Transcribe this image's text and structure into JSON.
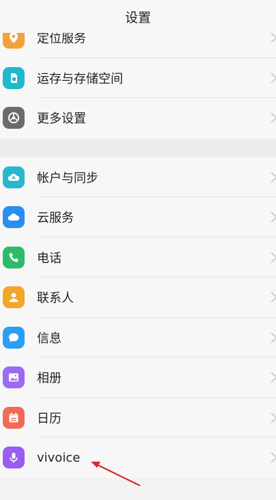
{
  "header": {
    "title": "设置"
  },
  "group1": [
    {
      "label": "定位服务",
      "icon": "location-icon",
      "color": "#f2a23a"
    },
    {
      "label": "运存与存储空间",
      "icon": "storage-icon",
      "color": "#1fb8cc"
    },
    {
      "label": "更多设置",
      "icon": "settings-icon",
      "color": "#6b6b6b"
    }
  ],
  "group2": [
    {
      "label": "帐户与同步",
      "icon": "account-sync-icon",
      "color": "#2ab6cf"
    },
    {
      "label": "云服务",
      "icon": "cloud-icon",
      "color": "#2a8ef0"
    },
    {
      "label": "电话",
      "icon": "phone-icon",
      "color": "#2dbb6a"
    },
    {
      "label": "联系人",
      "icon": "contacts-icon",
      "color": "#f2a62a"
    },
    {
      "label": "信息",
      "icon": "message-icon",
      "color": "#2a9ef5"
    },
    {
      "label": "相册",
      "icon": "album-icon",
      "color": "#9b6cf0"
    },
    {
      "label": "日历",
      "icon": "calendar-icon",
      "color": "#f06a5a"
    },
    {
      "label": "vivoice",
      "icon": "microphone-icon",
      "color": "#9b5cf0"
    }
  ],
  "annotation": {
    "arrow_color": "#d62a2a"
  }
}
